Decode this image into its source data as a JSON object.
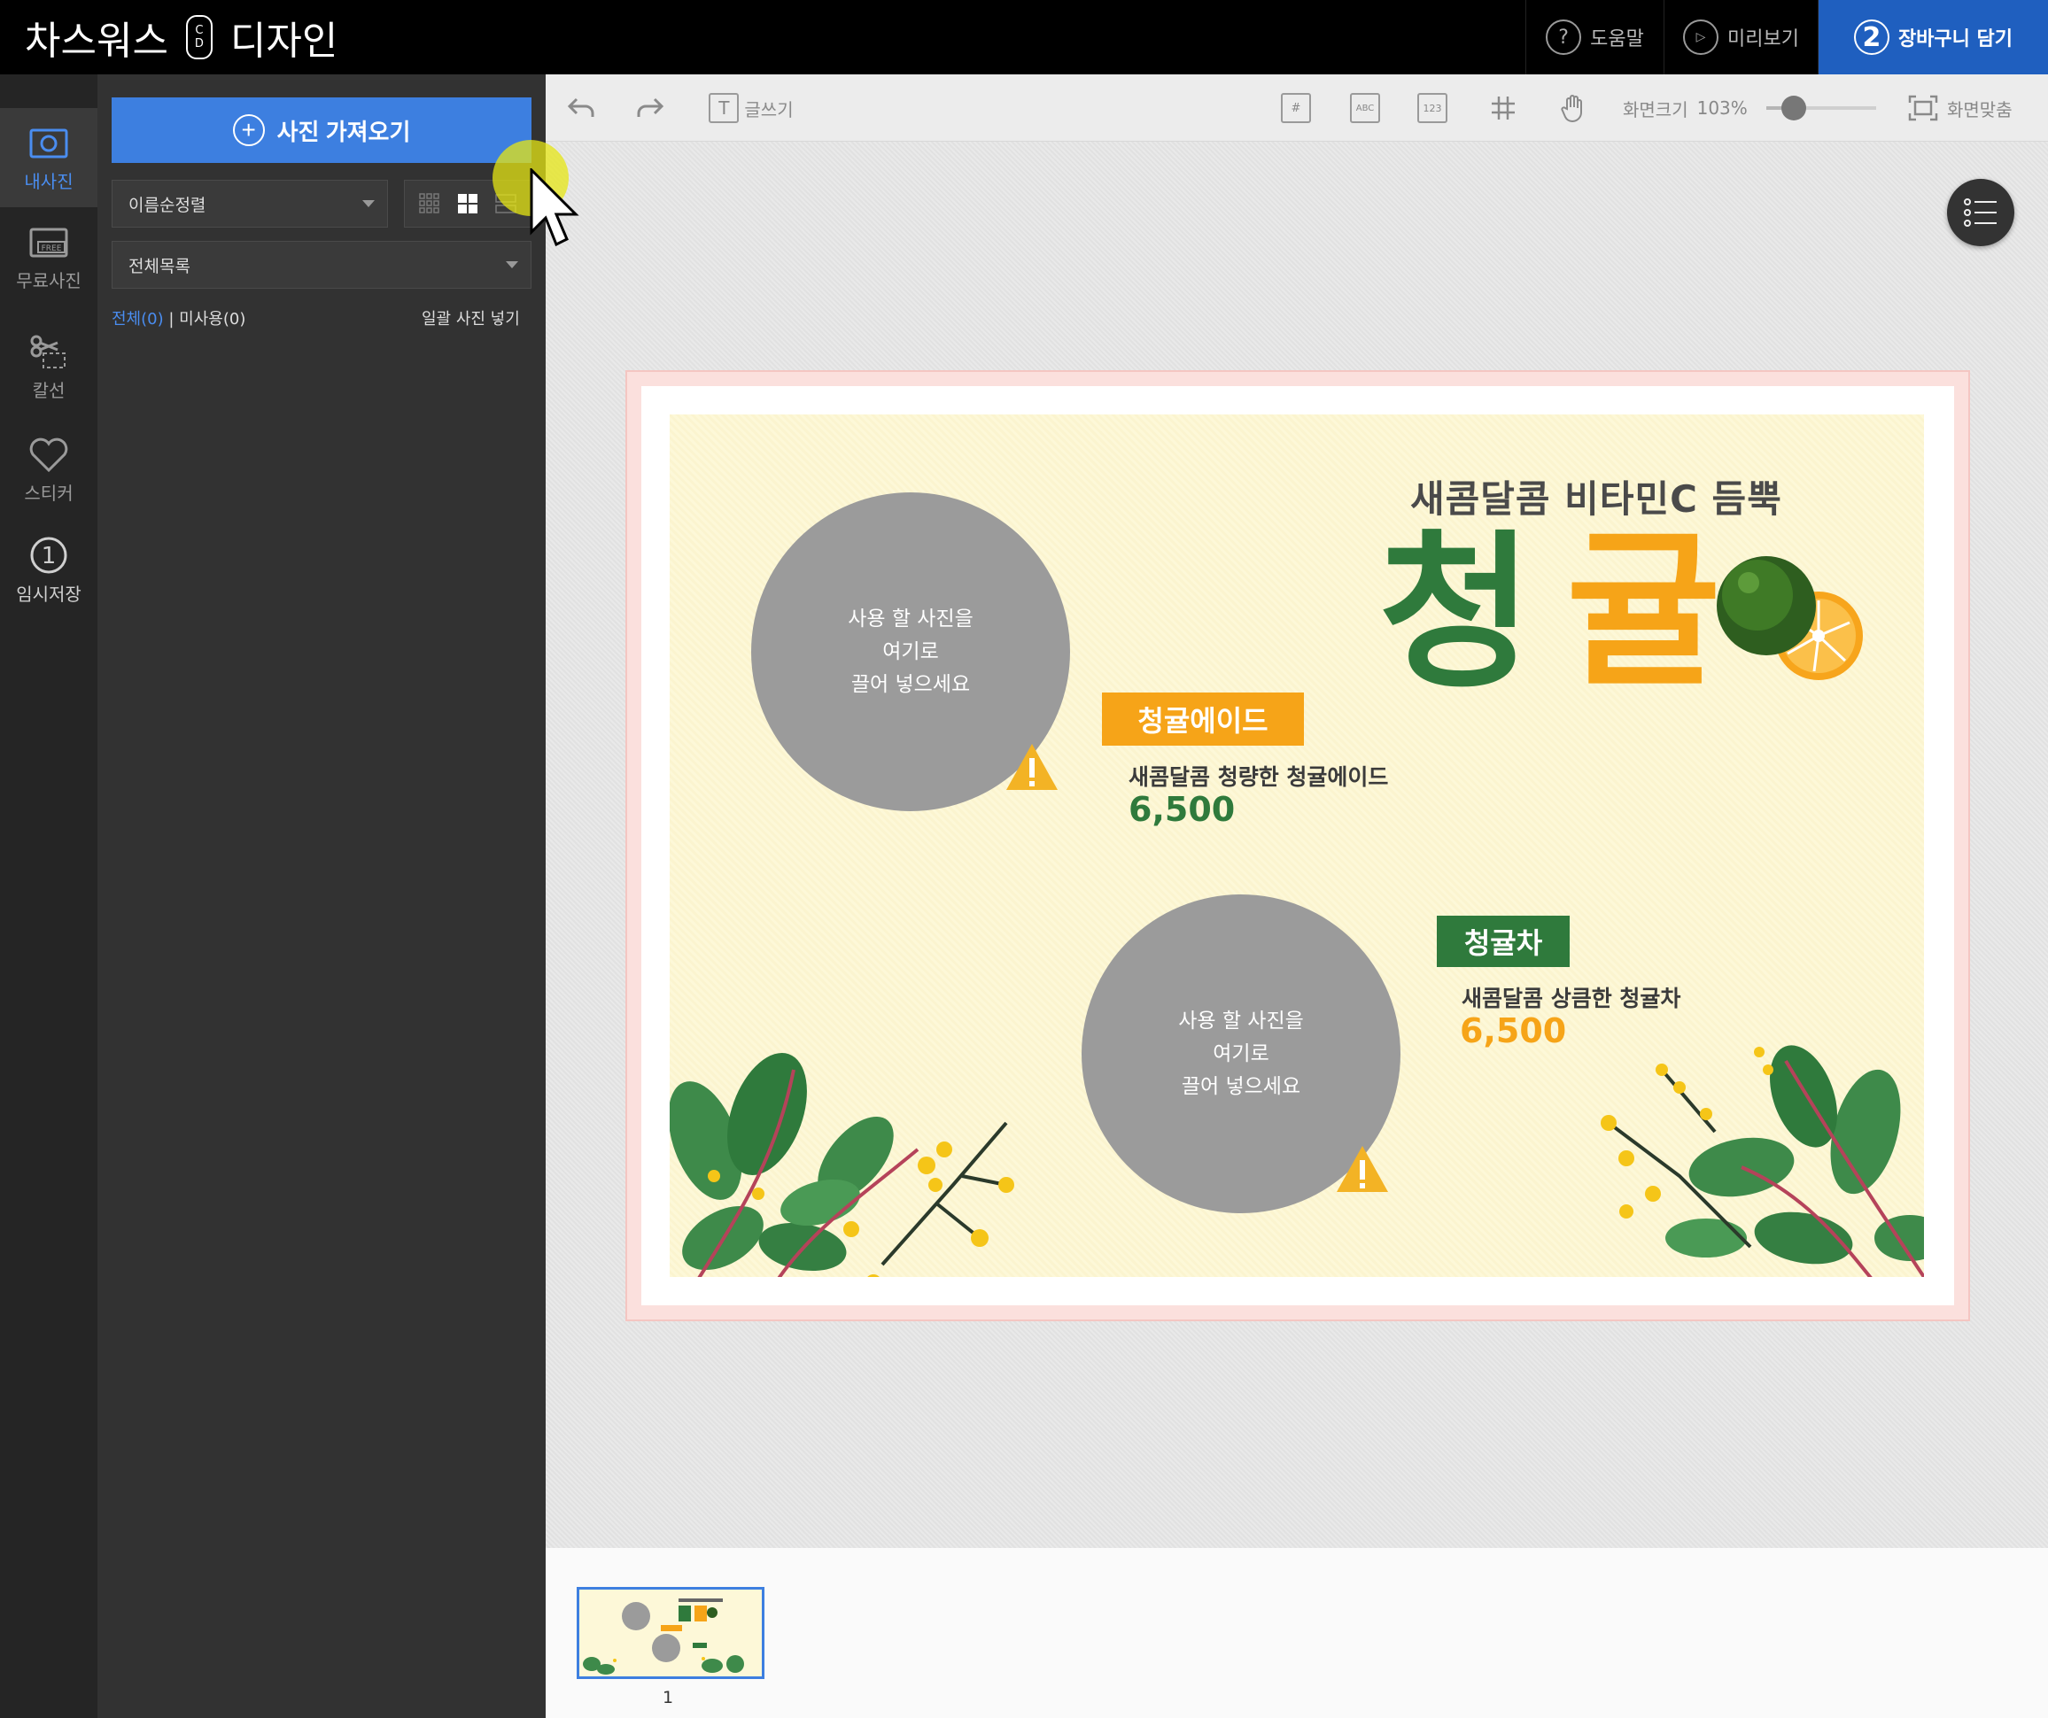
{
  "header": {
    "brand_left": "차스워스",
    "brand_logo_top": "C",
    "brand_logo_bottom": "D",
    "brand_right": "디자인",
    "help_label": "도움말",
    "preview_label": "미리보기",
    "cart_step": "2",
    "cart_label": "장바구니 담기"
  },
  "rail": {
    "items": [
      {
        "label": "내사진",
        "icon": "camera-icon",
        "active": true
      },
      {
        "label": "무료사진",
        "icon": "free-photo-icon",
        "active": false
      },
      {
        "label": "칼선",
        "icon": "scissors-icon",
        "active": false
      },
      {
        "label": "스티커",
        "icon": "heart-icon",
        "active": false
      },
      {
        "label": "임시저장",
        "icon": "number-one-icon",
        "step": "1",
        "active": false
      }
    ]
  },
  "panel": {
    "import_label": "사진 가져오기",
    "sort_value": "이름순정렬",
    "folder_value": "전체목록",
    "filter_all": "전체(0)",
    "filter_separator": "|",
    "filter_unused": "미사용(0)",
    "bulk_insert": "일괄 사진 넣기"
  },
  "toolbar": {
    "text_tool": "글쓰기",
    "icon_hash_page": "#",
    "icon_abc": "ABC",
    "icon_123": "123",
    "zoom_label": "화면크기",
    "zoom_value": "103%",
    "zoom_slider_fraction": 0.25,
    "fit_label": "화면맞춤"
  },
  "design": {
    "headline": "새콤달콤 비타민C 듬뿍",
    "big_word_1": "청",
    "big_word_2": "귤",
    "slot1_text": [
      "사용 할 사진을",
      "여기로",
      "끌어 넣으세요"
    ],
    "slot2_text": [
      "사용 할 사진을",
      "여기로",
      "끌어 넣으세요"
    ],
    "item1_tag": "청귤에이드",
    "item1_desc": "새콤달콤 청량한 청귤에이드",
    "item1_price": "6,500",
    "item2_tag": "청귤차",
    "item2_desc": "새콤달콤 상큼한 청귤차",
    "item2_price": "6,500",
    "colors": {
      "green": "#2f7a3c",
      "orange": "#f6a418",
      "background": "#fdf8d8",
      "leaf": "#3e8a4a",
      "berry": "#f5c518"
    }
  },
  "pages": {
    "items": [
      {
        "number": "1",
        "selected": true
      }
    ]
  }
}
